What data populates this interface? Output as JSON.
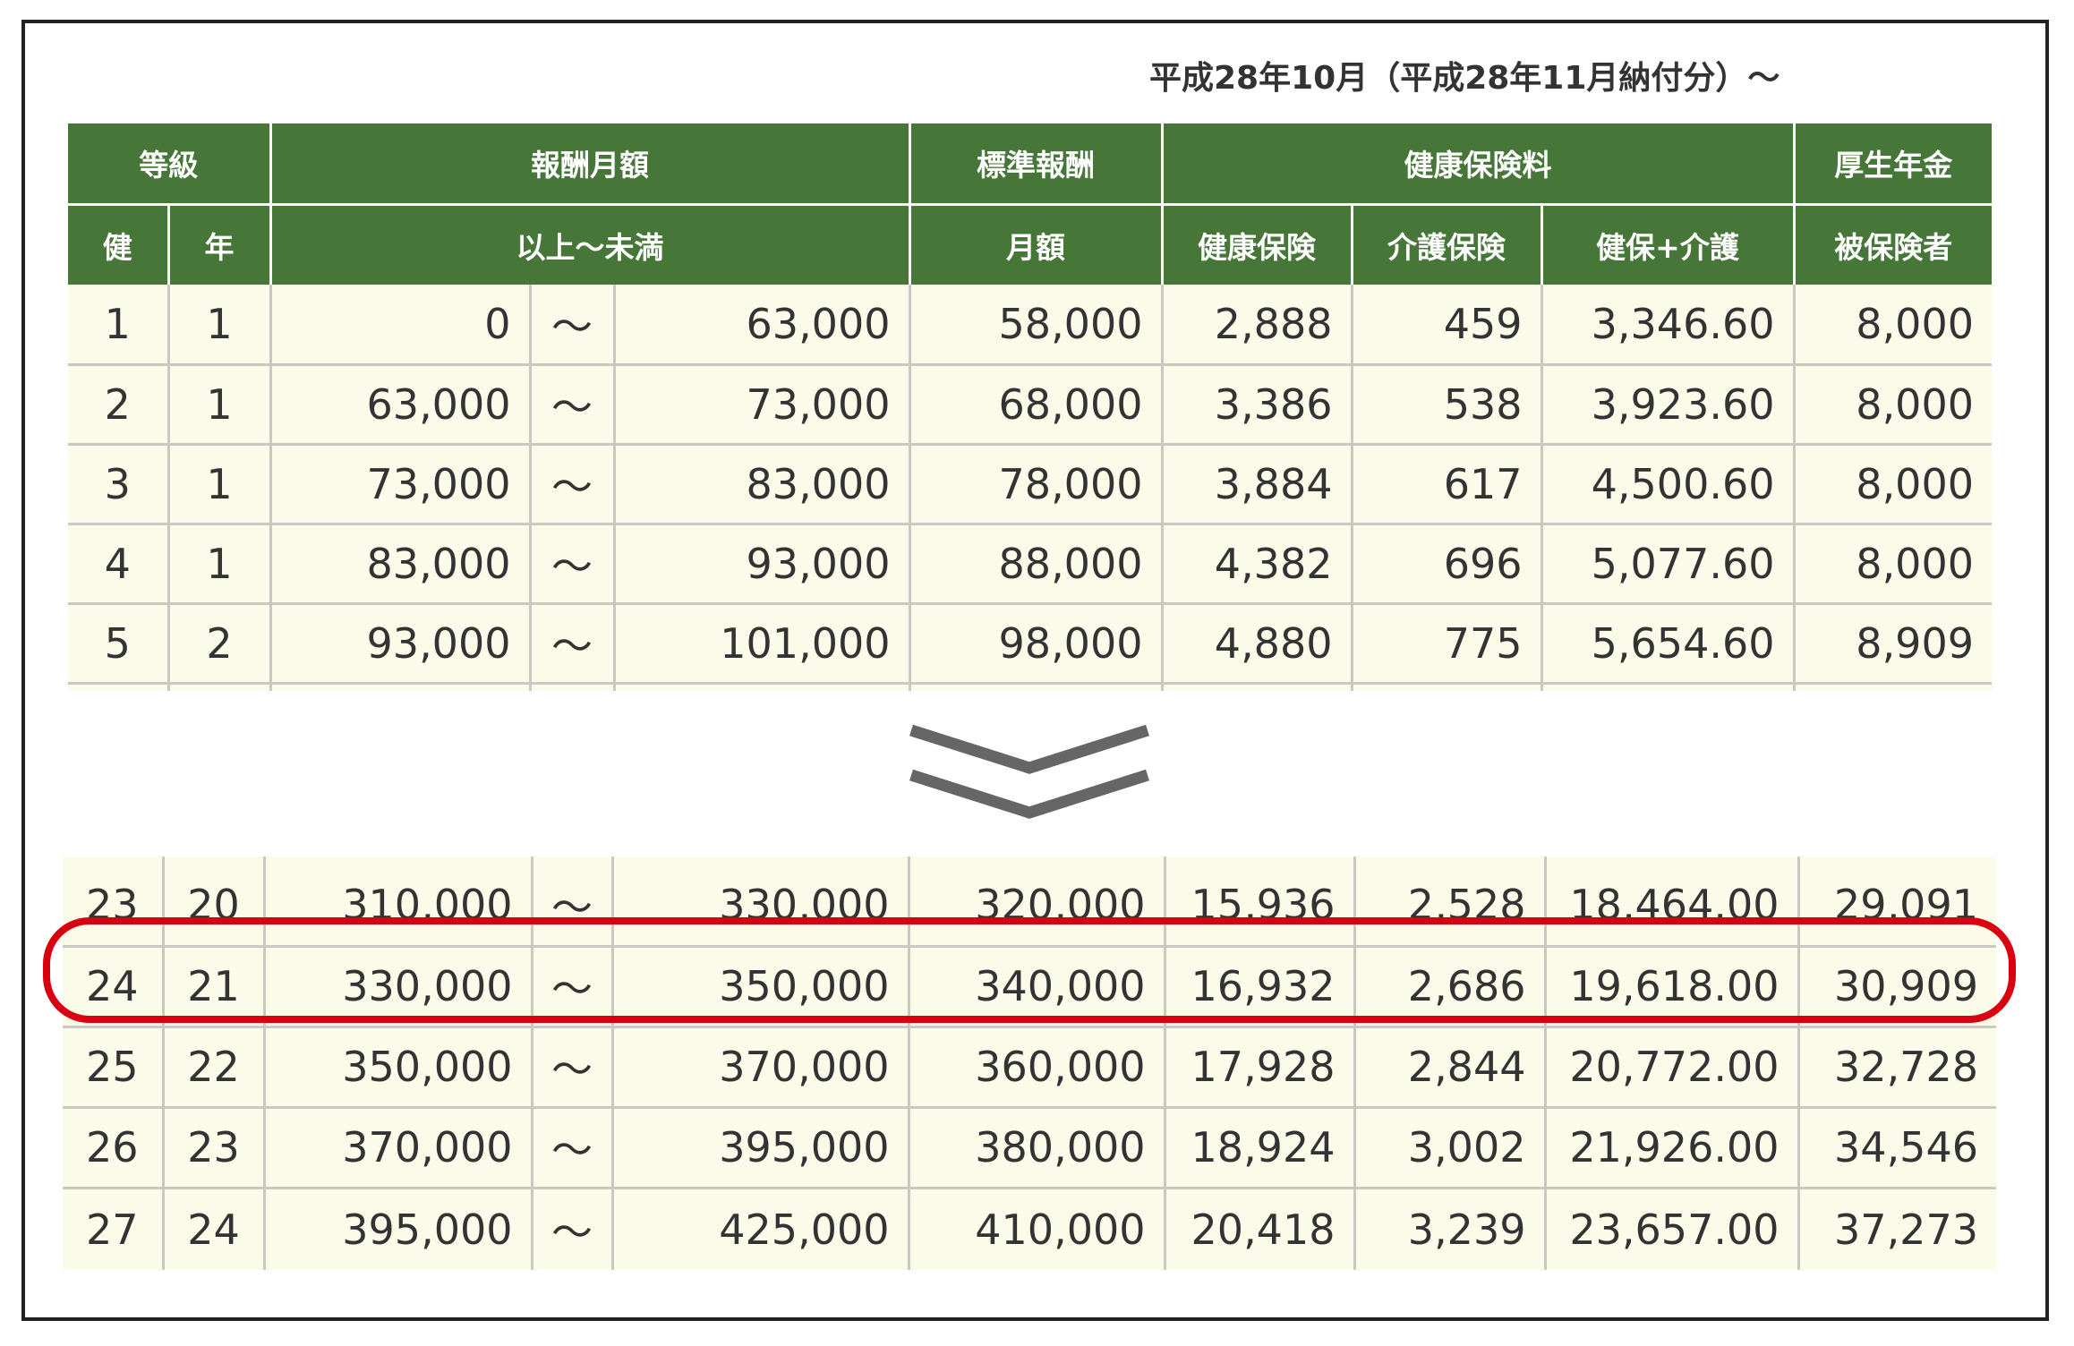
{
  "caption": "平成28年10月（平成28年11月納付分）〜",
  "header": {
    "row1": {
      "grade": "等級",
      "salary_range": "報酬月額",
      "standard": "標準報酬",
      "health_fee": "健康保険料",
      "pension": "厚生年金"
    },
    "row2": {
      "kenpo": "健",
      "nenkin": "年",
      "range": "以上〜未満",
      "monthly": "月額",
      "health": "健康保険",
      "care": "介護保険",
      "health_care": "健保+介護",
      "insured": "被保険者"
    }
  },
  "tilde": "〜",
  "top_rows": [
    {
      "kenpo": "1",
      "nenkin": "1",
      "from": "0",
      "to": "63,000",
      "monthly": "58,000",
      "health": "2,888",
      "care": "459",
      "health_care": "3,346.60",
      "pension": "8,000"
    },
    {
      "kenpo": "2",
      "nenkin": "1",
      "from": "63,000",
      "to": "73,000",
      "monthly": "68,000",
      "health": "3,386",
      "care": "538",
      "health_care": "3,923.60",
      "pension": "8,000"
    },
    {
      "kenpo": "3",
      "nenkin": "1",
      "from": "73,000",
      "to": "83,000",
      "monthly": "78,000",
      "health": "3,884",
      "care": "617",
      "health_care": "4,500.60",
      "pension": "8,000"
    },
    {
      "kenpo": "4",
      "nenkin": "1",
      "from": "83,000",
      "to": "93,000",
      "monthly": "88,000",
      "health": "4,382",
      "care": "696",
      "health_care": "5,077.60",
      "pension": "8,000"
    },
    {
      "kenpo": "5",
      "nenkin": "2",
      "from": "93,000",
      "to": "101,000",
      "monthly": "98,000",
      "health": "4,880",
      "care": "775",
      "health_care": "5,654.60",
      "pension": "8,909"
    }
  ],
  "bottom_rows": [
    {
      "kenpo": "23",
      "nenkin": "20",
      "from": "310,000",
      "to": "330,000",
      "monthly": "320,000",
      "health": "15,936",
      "care": "2,528",
      "health_care": "18,464.00",
      "pension": "29,091"
    },
    {
      "kenpo": "24",
      "nenkin": "21",
      "from": "330,000",
      "to": "350,000",
      "monthly": "340,000",
      "health": "16,932",
      "care": "2,686",
      "health_care": "19,618.00",
      "pension": "30,909"
    },
    {
      "kenpo": "25",
      "nenkin": "22",
      "from": "350,000",
      "to": "370,000",
      "monthly": "360,000",
      "health": "17,928",
      "care": "2,844",
      "health_care": "20,772.00",
      "pension": "32,728"
    },
    {
      "kenpo": "26",
      "nenkin": "23",
      "from": "370,000",
      "to": "395,000",
      "monthly": "380,000",
      "health": "18,924",
      "care": "3,002",
      "health_care": "21,926.00",
      "pension": "34,546"
    },
    {
      "kenpo": "27",
      "nenkin": "24",
      "from": "395,000",
      "to": "425,000",
      "monthly": "410,000",
      "health": "20,418",
      "care": "3,239",
      "health_care": "23,657.00",
      "pension": "37,273"
    }
  ],
  "highlighted_grade": "24",
  "colors": {
    "header_green": "#467638",
    "cell_bg": "#fbfbea",
    "highlight_red": "#d9000f",
    "chevron_gray": "#666666"
  },
  "icons": {
    "continuation": "double-chevron-down-icon"
  }
}
